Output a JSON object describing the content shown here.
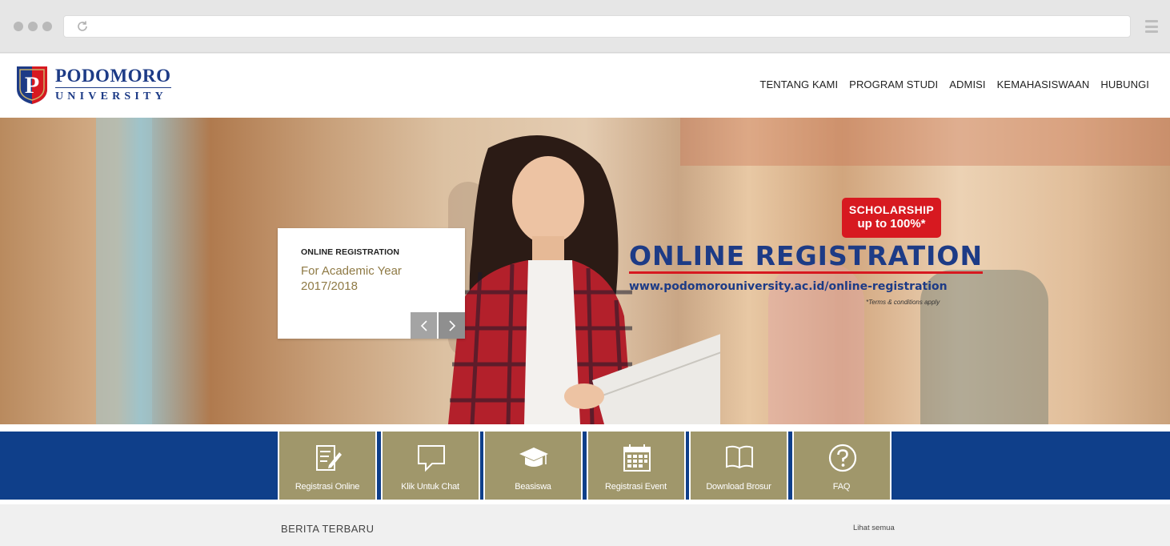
{
  "browser": {
    "url": ""
  },
  "logo": {
    "line1": "PODOMORO",
    "line2": "UNIVERSITY",
    "letter": "P"
  },
  "nav": {
    "items": [
      "TENTANG KAMI",
      "PROGRAM STUDI",
      "ADMISI",
      "KEMAHASISWAAN",
      "HUBUNGI"
    ]
  },
  "hero": {
    "card_kicker": "ONLINE REGISTRATION",
    "card_title": "For Academic Year 2017/2018",
    "prev_icon": "chevron-left-icon",
    "next_icon": "chevron-right-icon",
    "badge_line1": "SCHOLARSHIP",
    "badge_line2": "up to 100%*",
    "headline": "ONLINE REGISTRATION",
    "url": "www.podomorouniversity.ac.id/online-registration",
    "terms": "*Terms & conditions apply"
  },
  "quick_links": [
    {
      "label": "Registrasi Online",
      "icon": "form-edit-icon"
    },
    {
      "label": "Klik Untuk Chat",
      "icon": "chat-bubble-icon"
    },
    {
      "label": "Beasiswa",
      "icon": "graduation-cap-icon"
    },
    {
      "label": "Registrasi Event",
      "icon": "calendar-icon"
    },
    {
      "label": "Download Brosur",
      "icon": "book-icon"
    },
    {
      "label": "FAQ",
      "icon": "question-icon"
    }
  ],
  "news": {
    "title": "BERITA TERBARU",
    "more": "Lihat semua"
  },
  "colors": {
    "brand_blue": "#0f3f8a",
    "gold": "#a0976b",
    "red": "#d71920"
  }
}
